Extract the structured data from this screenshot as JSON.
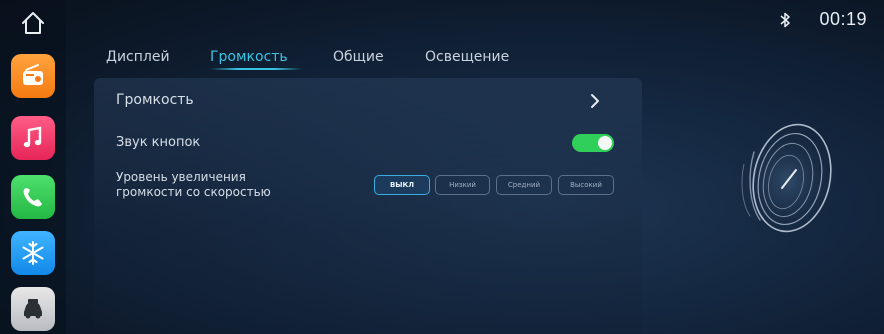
{
  "status": {
    "time": "00:19",
    "bluetooth_icon": "bluetooth-icon"
  },
  "dock": {
    "home_icon": "home-icon",
    "apps": [
      {
        "name": "radio",
        "icon": "radio-icon",
        "color": "#f57a12"
      },
      {
        "name": "music",
        "icon": "music-note-icon",
        "color": "#e52558"
      },
      {
        "name": "phone",
        "icon": "phone-icon",
        "color": "#23b744"
      },
      {
        "name": "climate",
        "icon": "snowflake-icon",
        "color": "#1189e8"
      },
      {
        "name": "car",
        "icon": "car-icon",
        "color": "#b9bcc2"
      }
    ]
  },
  "tabs": [
    "Дисплей",
    "Громкость",
    "Общие",
    "Освещение"
  ],
  "active_tab": "Громкость",
  "accent_color": "#39c3e3",
  "settings": {
    "volume_label": "Громкость",
    "key_sound_label": "Звук кнопок",
    "key_sound_enabled": true,
    "speed_volume_label_line1": "Уровень увеличения",
    "speed_volume_label_line2": "громкости со скоростью",
    "speed_volume_options": [
      "ВЫКЛ",
      "Низкий",
      "Средний",
      "Высокий"
    ],
    "speed_volume_selected": "ВЫКЛ"
  }
}
